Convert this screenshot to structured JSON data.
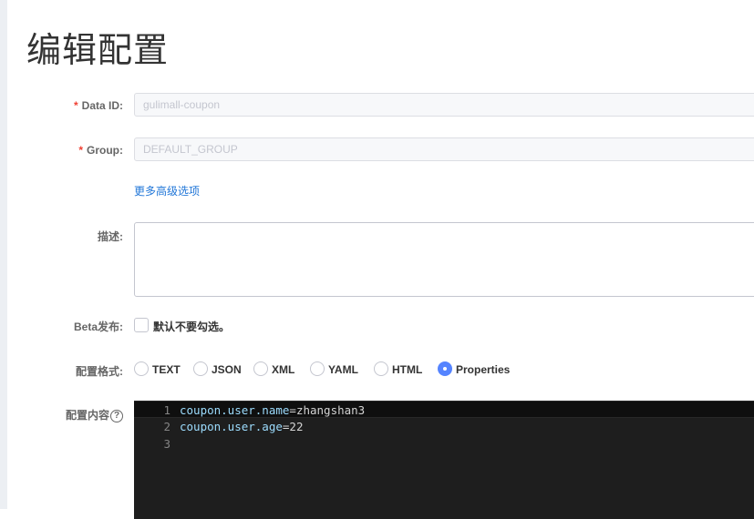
{
  "page": {
    "title": "编辑配置"
  },
  "form": {
    "data_id": {
      "label": "Data ID:",
      "required_mark": "*",
      "value": "gulimall-coupon"
    },
    "group": {
      "label": "Group:",
      "required_mark": "*",
      "value": "DEFAULT_GROUP"
    },
    "advanced_link": "更多高级选项",
    "description": {
      "label": "描述:",
      "value": ""
    },
    "beta": {
      "label": "Beta发布:",
      "checkbox_label": "默认不要勾选。",
      "checked": false
    },
    "format": {
      "label": "配置格式:",
      "options": [
        "TEXT",
        "JSON",
        "XML",
        "YAML",
        "HTML",
        "Properties"
      ],
      "selected": "Properties"
    },
    "content": {
      "label": "配置内容",
      "help_glyph": "?",
      "lines": [
        {
          "no": "1",
          "key": "coupon.user.name",
          "eq": "=",
          "value": "zhangshan3"
        },
        {
          "no": "2",
          "key": "coupon.user.age",
          "eq": "=",
          "value": "22"
        },
        {
          "no": "3",
          "key": "",
          "eq": "",
          "value": ""
        }
      ]
    }
  }
}
